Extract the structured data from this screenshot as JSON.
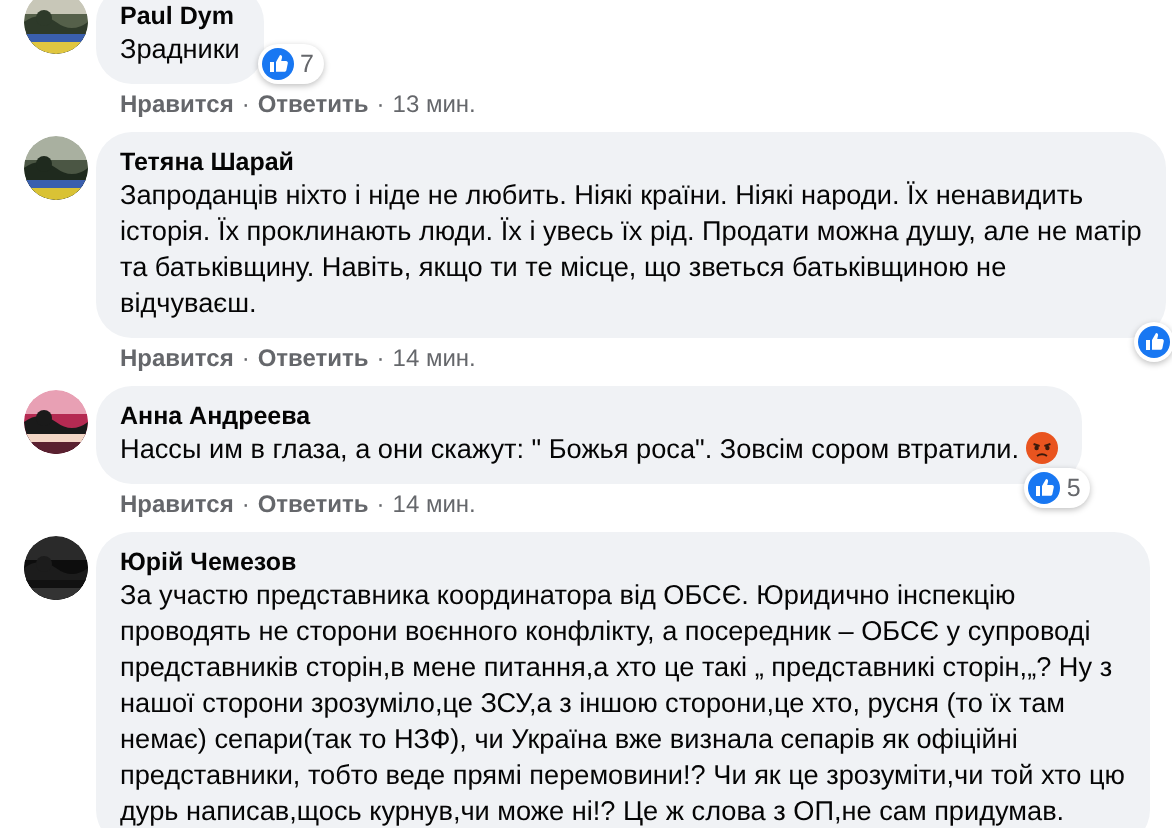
{
  "separator": "·",
  "comments": [
    {
      "author": "Paul Dym",
      "lines": [
        "Зрадники"
      ],
      "reaction": {
        "kind": "like",
        "count": "7"
      },
      "like": "Нравится",
      "reply": "Ответить",
      "time": "13 мин."
    },
    {
      "author": "Тетяна Шарай",
      "lines": [
        "Запроданців ніхто і ніде не любить. Ніякі країни. Ніякі народи. Їх ненавидить",
        "історія. Їх проклинають люди. Їх і увесь їх рід. Продати можна душу, але не матір",
        "та батьківщину. Навіть, якщо ти те місце, що зветься батьківщиною не",
        "відчуваєш."
      ],
      "reaction": {
        "kind": "like"
      },
      "like": "Нравится",
      "reply": "Ответить",
      "time": "14 мин."
    },
    {
      "author": "Анна Андреева",
      "lines": [
        "Нассы им в глаза, а они скажут: \" Божья роса\". Зовсім сором втратили."
      ],
      "emoji": {
        "kind": "angry"
      },
      "reaction": {
        "kind": "like",
        "count": "5"
      },
      "like": "Нравится",
      "reply": "Ответить",
      "time": "14 мин."
    },
    {
      "author": "Юрій Чемезов",
      "lines": [
        "За участю представника координатора від ОБСЄ. Юридично інспекцію",
        "проводять не сторони воєнного конфлікту, а посередник – ОБСЄ у супроводі",
        "представників сторін,в мене питання,а хто це такі „ представникі сторін,„? Ну з",
        "нашої сторони зрозуміло,це ЗСУ,а з іншою сторони,це хто, русня (то їх там",
        "немає) сепари(так то НЗФ), чи Україна вже визнала сепарів як офіційні",
        "представники, тобто веде прямі перемовини!? Чи як це зрозуміти,чи той хто цю",
        "дурь написав,щось курнув,чи може ні!? Це ж слова з ОП,не сам придумав."
      ]
    }
  ]
}
